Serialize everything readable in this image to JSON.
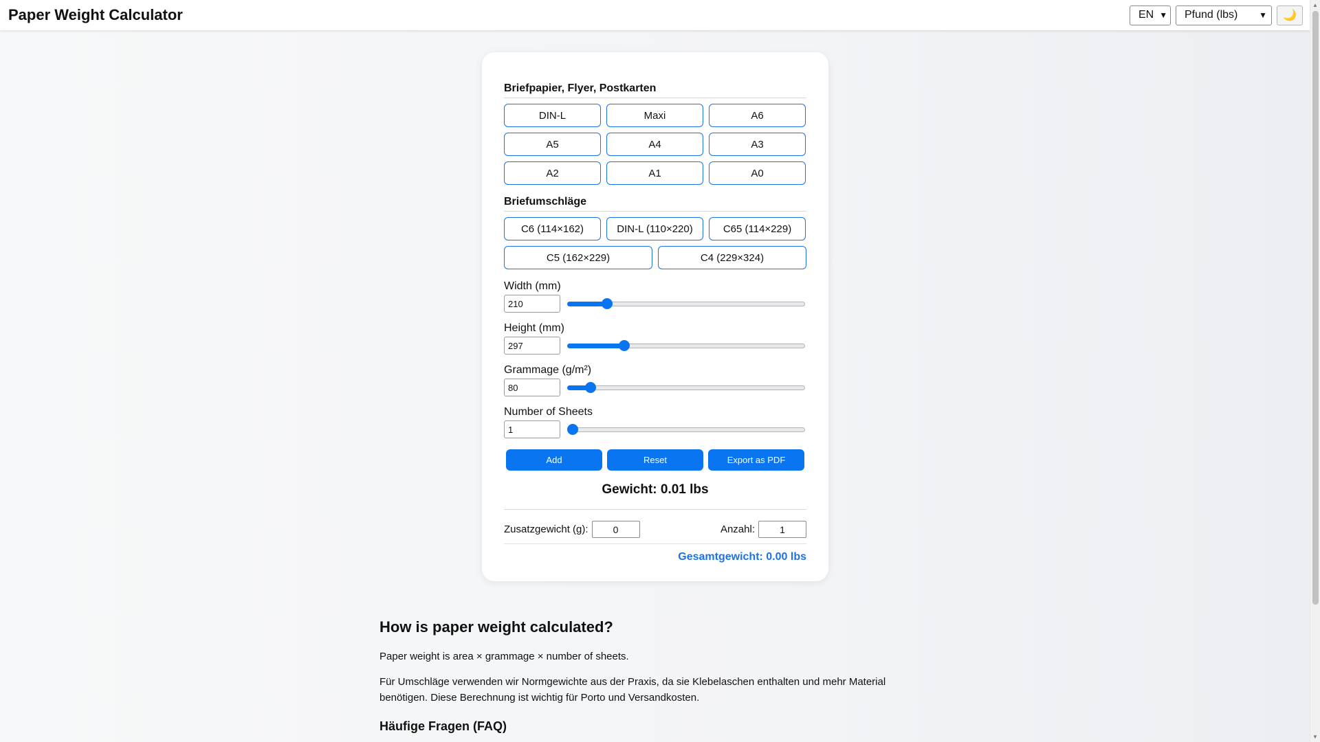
{
  "header": {
    "title": "Paper Weight Calculator",
    "language": "EN",
    "unit": "Pfund (lbs)",
    "theme_icon": "moon-icon",
    "theme_glyph": "🌙"
  },
  "presets": {
    "paper_title": "Briefpapier, Flyer, Postkarten",
    "paper": [
      "DIN-L",
      "Maxi",
      "A6",
      "A5",
      "A4",
      "A3",
      "A2",
      "A1",
      "A0"
    ],
    "envelope_title": "Briefumschläge",
    "envelopes_row1": [
      "C6 (114×162)",
      "DIN-L (110×220)",
      "C65 (114×229)"
    ],
    "envelopes_row2": [
      "C5 (162×229)",
      "C4 (229×324)"
    ]
  },
  "fields": {
    "width": {
      "label": "Width (mm)",
      "value": "210",
      "fraction": 0.15
    },
    "height": {
      "label": "Height (mm)",
      "value": "297",
      "fraction": 0.226
    },
    "grammage": {
      "label": "Grammage (g/m²)",
      "value": "80",
      "fraction": 0.08
    },
    "sheets": {
      "label": "Number of Sheets",
      "value": "1",
      "fraction": 0.0
    }
  },
  "actions": {
    "add": "Add",
    "reset": "Reset",
    "export": "Export as PDF"
  },
  "result": {
    "weight": "Gewicht: 0.01 lbs",
    "extra_label": "Zusatzgewicht (g):",
    "extra_value": "0",
    "count_label": "Anzahl:",
    "count_value": "1",
    "total": "Gesamtgewicht: 0.00 lbs"
  },
  "colors": {
    "accent": "#0a75f0",
    "total_text": "#1a73e8"
  },
  "article": {
    "heading": "How is paper weight calculated?",
    "p1": "Paper weight is area × grammage × number of sheets.",
    "p2": "Für Umschläge verwenden wir Normgewichte aus der Praxis, da sie Klebelaschen enthalten und mehr Material benötigen. Diese Berechnung ist wichtig für Porto und Versandkosten.",
    "faq_heading": "Häufige Fragen (FAQ)"
  }
}
